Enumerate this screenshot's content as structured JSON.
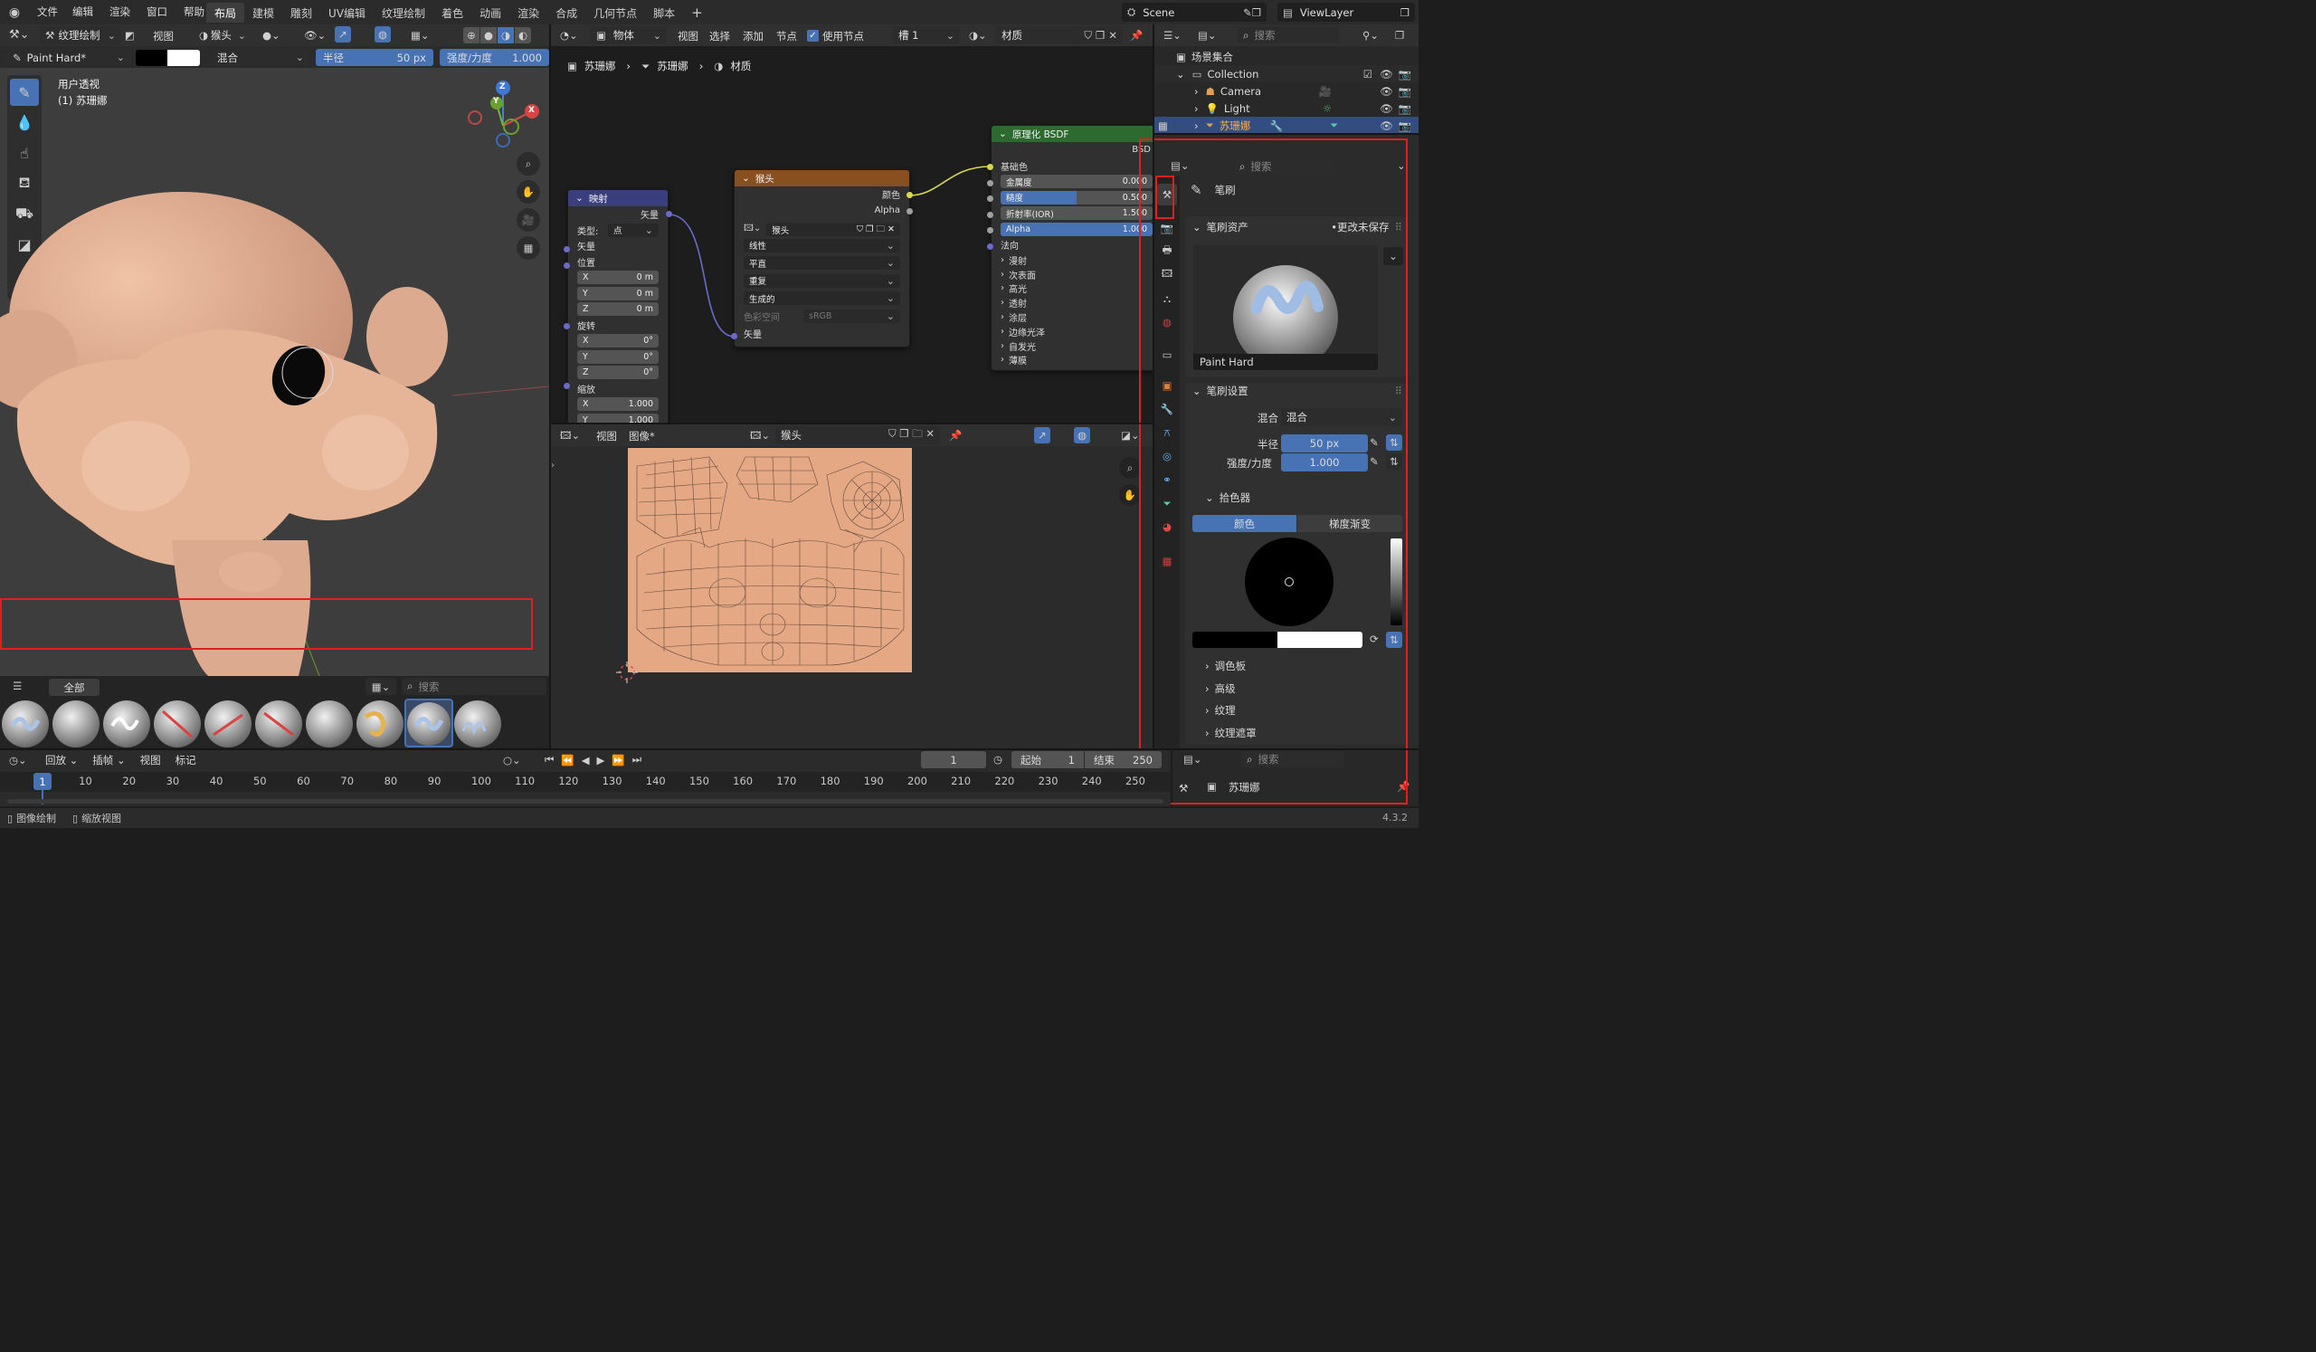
{
  "topbar": {
    "menus": [
      "文件",
      "编辑",
      "渲染",
      "窗口",
      "帮助"
    ],
    "workspaces": [
      "布局",
      "建模",
      "雕刻",
      "UV编辑",
      "纹理绘制",
      "着色",
      "动画",
      "渲染",
      "合成",
      "几何节点",
      "脚本"
    ],
    "active_workspace": "布局",
    "scene_name": "Scene",
    "view_layer": "ViewLayer"
  },
  "viewport": {
    "mode": "纹理绘制",
    "view_menu": "视图",
    "texture_slot": "猴头",
    "brush_name": "Paint Hard*",
    "blend": "混合",
    "radius_label": "半径",
    "radius_value": "50 px",
    "strength_label": "强度/力度",
    "strength_value": "1.000",
    "overlay_line1": "用户透视",
    "overlay_line2": "(1) 苏珊娜",
    "axis_z": "Z",
    "axis_y": "Y",
    "axis_x": "X"
  },
  "asset_shelf": {
    "tab": "全部",
    "search_placeholder": "搜索"
  },
  "node_editor": {
    "object_menu": "物体",
    "menus": [
      "视图",
      "选择",
      "添加",
      "节点"
    ],
    "use_nodes": "使用节点",
    "slot": "槽 1",
    "material": "材质",
    "breadcrumb": [
      "苏珊娜",
      "苏珊娜",
      "材质"
    ],
    "mapping": {
      "title": "映射",
      "out_vector": "矢量",
      "type_label": "类型:",
      "type_value": "点",
      "in_vector": "矢量",
      "location": "位置",
      "loc": [
        [
          "X",
          "0 m"
        ],
        [
          "Y",
          "0 m"
        ],
        [
          "Z",
          "0 m"
        ]
      ],
      "rotation": "旋转",
      "rot": [
        [
          "X",
          "0°"
        ],
        [
          "Y",
          "0°"
        ],
        [
          "Z",
          "0°"
        ]
      ],
      "scale": "缩放",
      "scl": [
        [
          "X",
          "1.000"
        ],
        [
          "Y",
          "1.000"
        ]
      ]
    },
    "image_tex": {
      "title": "猴头",
      "out_color": "颜色",
      "out_alpha": "Alpha",
      "image": "猴头",
      "interp": "线性",
      "proj": "平直",
      "ext": "重复",
      "source": "生成的",
      "colorspace_label": "色彩空间",
      "colorspace_value": "sRGB",
      "in_vector": "矢量"
    },
    "bsdf": {
      "title": "原理化 BSDF",
      "out_short": "BSD",
      "base_color": "基础色",
      "fields": [
        [
          "金属度",
          "0.000",
          0.0
        ],
        [
          "糙度",
          "0.500",
          0.5
        ],
        [
          "折射率(IOR)",
          "1.500",
          0.0
        ],
        [
          "Alpha",
          "1.000",
          1.0
        ]
      ],
      "normal": "法向",
      "panels": [
        "漫射",
        "次表面",
        "高光",
        "透射",
        "涂层",
        "边缘光泽",
        "自发光",
        "薄膜"
      ]
    }
  },
  "image_editor": {
    "view": "视图",
    "image_menu": "图像*",
    "image_name": "猴头"
  },
  "outliner": {
    "search_placeholder": "搜索",
    "root": "场景集合",
    "items": [
      {
        "name": "Collection",
        "level": 1
      },
      {
        "name": "Camera",
        "level": 2
      },
      {
        "name": "Light",
        "level": 2
      },
      {
        "name": "苏珊娜",
        "level": 2,
        "selected": true
      }
    ]
  },
  "properties": {
    "search_placeholder": "搜索",
    "section": "笔刷",
    "assets": "笔刷资产",
    "unsaved": "•更改未保存",
    "brush_preview_name": "Paint Hard",
    "settings": "笔刷设置",
    "blend_label": "混合",
    "blend_value": "混合",
    "radius_label": "半径",
    "radius_value": "50 px",
    "strength_label": "强度/力度",
    "strength_value": "1.000",
    "picker": "拾色器",
    "color_tab": "颜色",
    "gradient_tab": "梯度渐变",
    "subpanels": [
      "调色板",
      "高级",
      "纹理",
      "纹理遮罩"
    ],
    "bottom_object": "苏珊娜"
  },
  "timeline": {
    "playback": "回放",
    "keying": "插帧",
    "view": "视图",
    "marker": "标记",
    "current_frame": "1",
    "start_label": "起始",
    "start": "1",
    "end_label": "结束",
    "end": "250",
    "ticks": [
      "1",
      "10",
      "20",
      "30",
      "40",
      "50",
      "60",
      "70",
      "80",
      "90",
      "100",
      "110",
      "120",
      "130",
      "140",
      "150",
      "160",
      "170",
      "180",
      "190",
      "200",
      "210",
      "220",
      "230",
      "240",
      "250"
    ]
  },
  "statusbar": {
    "left1": "图像绘制",
    "left2": "缩放视图",
    "version": "4.3.2"
  },
  "colors": {
    "accent_blue": "#4772b3",
    "highlight_red": "#e02020",
    "texture_node_header": "#8a4f1f",
    "mapping_node_header": "#3b3e7e",
    "bsdf_node_header": "#2c6a30",
    "uv_canvas": "#e5a884"
  }
}
